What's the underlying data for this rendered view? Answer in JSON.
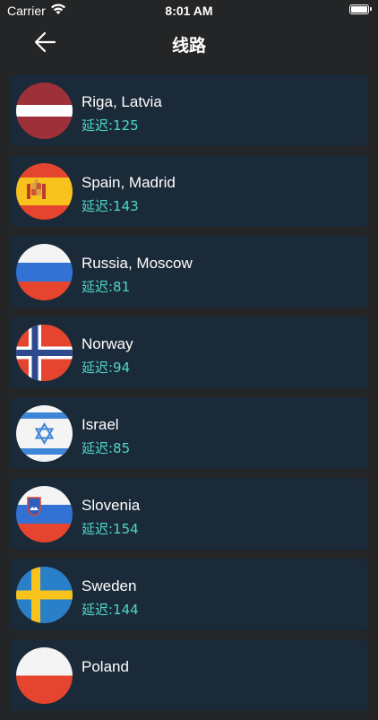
{
  "status_bar": {
    "carrier": "Carrier",
    "time": "8:01 AM"
  },
  "nav": {
    "title": "线路",
    "back_icon": "arrow-left-icon"
  },
  "colors": {
    "background": "#232527",
    "card": "#1b2a38",
    "latency_text": "#4fd6c9"
  },
  "servers": [
    {
      "name": "Riga, Latvia",
      "latency": "延迟:125",
      "flag": "latvia-flag-icon"
    },
    {
      "name": "Spain, Madrid",
      "latency": "延迟:143",
      "flag": "spain-flag-icon"
    },
    {
      "name": "Russia, Moscow",
      "latency": "延迟:81",
      "flag": "russia-flag-icon"
    },
    {
      "name": "Norway",
      "latency": "延迟:94",
      "flag": "norway-flag-icon"
    },
    {
      "name": "Israel",
      "latency": "延迟:85",
      "flag": "israel-flag-icon"
    },
    {
      "name": "Slovenia",
      "latency": "延迟:154",
      "flag": "slovenia-flag-icon"
    },
    {
      "name": "Sweden",
      "latency": "延迟:144",
      "flag": "sweden-flag-icon"
    },
    {
      "name": "Poland",
      "latency": "",
      "flag": "poland-flag-icon"
    }
  ]
}
